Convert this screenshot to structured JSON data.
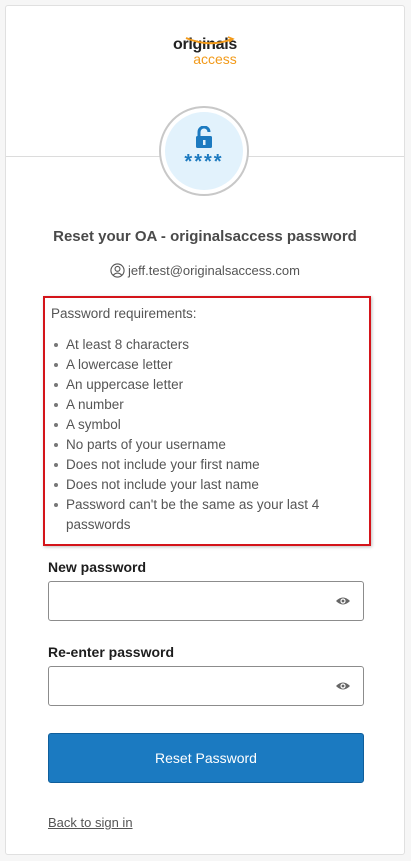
{
  "logo": {
    "line1": "originals",
    "line2": "access"
  },
  "lock": {
    "stars": "****"
  },
  "title": "Reset your OA - originalsaccess password",
  "identifier": "jeff.test@originalsaccess.com",
  "requirements": {
    "title": "Password requirements:",
    "items": [
      "At least 8 characters",
      "A lowercase letter",
      "An uppercase letter",
      "A number",
      "A symbol",
      "No parts of your username",
      "Does not include your first name",
      "Does not include your last name",
      "Password can't be the same as your last 4 passwords"
    ]
  },
  "new_password": {
    "label": "New password",
    "value": ""
  },
  "reenter_password": {
    "label": "Re-enter password",
    "value": ""
  },
  "submit": {
    "label": "Reset Password"
  },
  "back_link": {
    "label": "Back to sign in"
  },
  "colors": {
    "primary_button": "#1b7ac1",
    "highlight_border": "#d4141a",
    "brand_orange": "#f29a1a",
    "lock_blue": "#1c7ac0"
  },
  "icons": {
    "lock": "padlock-open-icon",
    "identifier": "user-circle-icon",
    "reveal": "eye-icon"
  }
}
